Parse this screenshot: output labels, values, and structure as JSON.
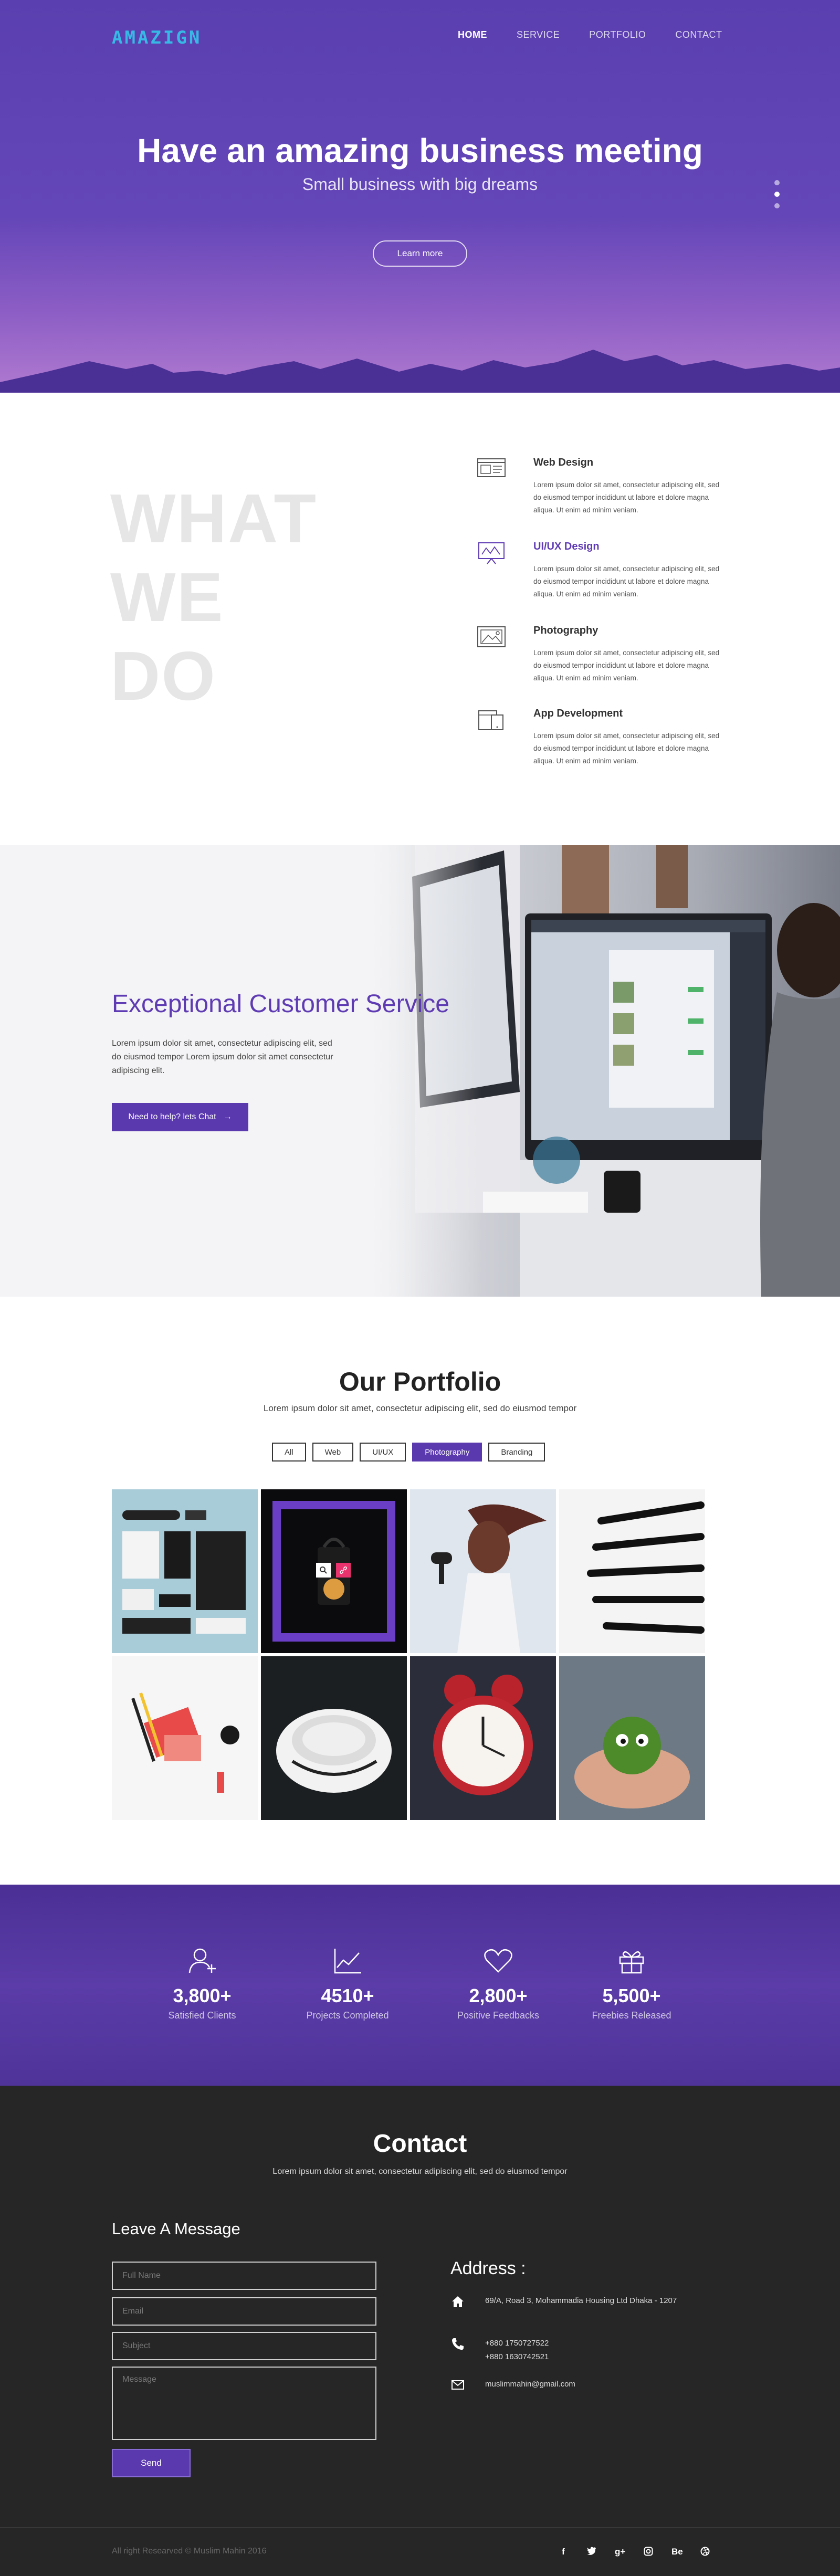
{
  "header": {
    "logo": "AMAZIGN",
    "nav": [
      "HOME",
      "SERVICE",
      "PORTFOLIO",
      "CONTACT"
    ]
  },
  "hero": {
    "title": "Have an amazing business meeting",
    "subtitle": "Small business with big dreams",
    "button": "Learn more",
    "slides_count": 3,
    "active_slide": 1
  },
  "what_we_do": {
    "heading": [
      "WHAT",
      "WE",
      "DO"
    ],
    "services": [
      {
        "title": "Web Design",
        "icon": "browser-window-icon",
        "desc": "Lorem ipsum dolor sit amet, consectetur adipiscing elit, sed do eiusmod tempor incididunt ut labore et dolore magna aliqua. Ut enim ad minim veniam."
      },
      {
        "title": "UI/UX Design",
        "icon": "design-easel-icon",
        "desc": "Lorem ipsum dolor sit amet, consectetur adipiscing elit, sed do eiusmod tempor incididunt ut labore et dolore magna aliqua. Ut enim ad minim veniam."
      },
      {
        "title": "Photography",
        "icon": "picture-icon",
        "desc": "Lorem ipsum dolor sit amet, consectetur adipiscing elit, sed do eiusmod tempor incididunt ut labore et dolore magna aliqua. Ut enim ad minim veniam."
      },
      {
        "title": "App Development",
        "icon": "devices-icon",
        "desc": "Lorem ipsum dolor sit amet, consectetur adipiscing elit, sed do eiusmod tempor incididunt ut labore et dolore magna aliqua. Ut enim ad minim veniam."
      }
    ]
  },
  "customer_service": {
    "title": "Exceptional Customer Service",
    "text": "Lorem ipsum dolor sit amet, consectetur adipiscing elit, sed do eiusmod tempor Lorem ipsum dolor sit amet consectetur adipiscing elit.",
    "button": "Need to help? lets Chat",
    "button_arrow": "→"
  },
  "portfolio": {
    "title": "Our Portfolio",
    "subtitle": "Lorem ipsum dolor sit amet, consectetur adipiscing elit, sed do eiusmod tempor",
    "filters": [
      "All",
      "Web",
      "UI/UX",
      "Photography",
      "Branding"
    ],
    "active_filter": "Photography",
    "tiles": [
      "stationery",
      "lantern",
      "hair-dryer",
      "pencils",
      "desk-items",
      "ashtray",
      "alarm-clock",
      "moss-ball"
    ]
  },
  "stats": [
    {
      "value": "3,800+",
      "label": "Satisfied Clients",
      "icon": "add-user-icon"
    },
    {
      "value": "4510+",
      "label": "Projects Completed",
      "icon": "line-chart-icon"
    },
    {
      "value": "2,800+",
      "label": "Positive Feedbacks",
      "icon": "heart-icon"
    },
    {
      "value": "5,500+",
      "label": "Freebies Released",
      "icon": "gift-icon"
    }
  ],
  "contact": {
    "title": "Contact",
    "subtitle": "Lorem ipsum dolor sit amet, consectetur adipiscing elit, sed do eiusmod tempor",
    "form_title": "Leave A Message",
    "placeholders": {
      "name": "Full Name",
      "email": "Email",
      "subject": "Subject",
      "message": "Message"
    },
    "send": "Send",
    "address_title": "Address :",
    "address": "69/A, Road 3, Mohammadia Housing Ltd Dhaka - 1207",
    "phones": [
      "+880 1750727522",
      "+880 1630742521"
    ],
    "email": "muslimmahin@gmail.com"
  },
  "footer": {
    "copyright": "All right Researved © Muslim Mahin 2016",
    "social": [
      "f",
      "t",
      "g+",
      "ig",
      "Be",
      "dr"
    ]
  },
  "colors": {
    "accent": "#5a38ad",
    "logo": "#37b9e6",
    "dark": "#262626"
  }
}
